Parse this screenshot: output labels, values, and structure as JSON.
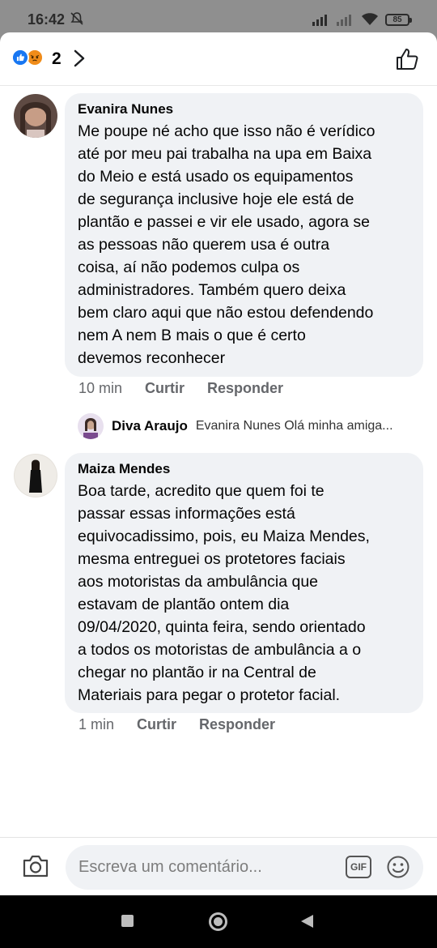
{
  "status_bar": {
    "time": "16:42",
    "battery": "85"
  },
  "reactions": {
    "count": "2"
  },
  "comments": [
    {
      "author": "Evanira Nunes",
      "text": "Me poupe né acho que isso não é verídico\naté por meu pai trabalha na upa em Baixa\ndo Meio e está usado os equipamentos\nde segurança inclusive hoje ele está de\nplantão e passei e vir ele usado, agora se\nas pessoas não querem usa é outra\ncoisa, aí não podemos culpa os\nadministradores. Também quero deixa\nbem claro aqui que não estou defendendo\nnem A nem B mais o que é certo\ndevemos reconhecer",
      "time": "10 min",
      "like_label": "Curtir",
      "reply_label": "Responder"
    },
    {
      "author": "Maiza Mendes",
      "text": "Boa tarde, acredito que quem foi te\npassar essas informações está\nequivocadissimo, pois, eu Maiza Mendes,\nmesma entreguei os protetores faciais\naos motoristas da ambulância que\nestavam de plantão ontem dia\n09/04/2020, quinta feira, sendo orientado\na todos os motoristas de ambulância a o\nchegar no plantão ir na Central de\nMateriais para pegar o protetor facial.",
      "time": "1 min",
      "like_label": "Curtir",
      "reply_label": "Responder"
    }
  ],
  "reply_preview": {
    "author": "Diva Araujo",
    "text": "Evanira Nunes Olá minha amiga..."
  },
  "composer": {
    "placeholder": "Escreva um comentário...",
    "gif_label": "GIF"
  },
  "colors": {
    "like_blue": "#1877f2",
    "bubble_bg": "#f0f2f5",
    "meta_gray": "#65676b"
  },
  "icons": [
    "dnd-icon",
    "signal-icon",
    "wifi-icon",
    "battery-icon",
    "like-reaction-icon",
    "angry-reaction-icon",
    "chevron-right-icon",
    "thumbs-up-icon",
    "camera-icon",
    "gif-icon",
    "emoji-icon",
    "recents-icon",
    "home-icon",
    "back-icon"
  ]
}
